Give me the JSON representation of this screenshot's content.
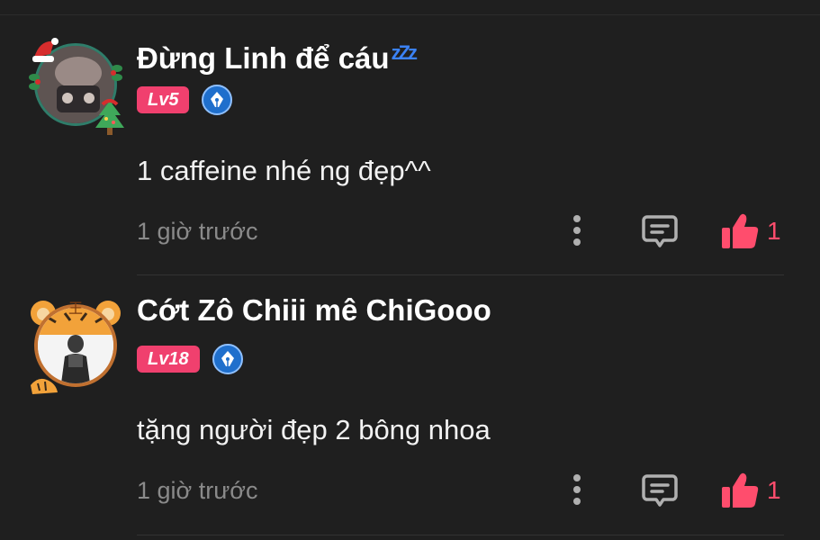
{
  "colors": {
    "background": "#1f1f1f",
    "level_badge": "#f0406e",
    "like_accent": "#ff4d6d",
    "verified_badge": "#1f6fcc",
    "time_text": "#8a8a8a"
  },
  "comments": [
    {
      "username": "Đừng Linh để cáu",
      "username_suffix": "zZz",
      "level": "Lv5",
      "text": "1 caffeine nhé ng đẹp^^",
      "time": "1 giờ trước",
      "likes": "1",
      "avatar_frame": "christmas-frame"
    },
    {
      "username": "Cớt Zô Chiii mê ChiGooo",
      "level": "Lv18",
      "text": "tặng người đẹp 2 bông nhoa",
      "time": "1 giờ trước",
      "likes": "1",
      "avatar_frame": "tiger-frame"
    }
  ],
  "icons": {
    "more": "more-vertical-icon",
    "reply": "comment-reply-icon",
    "like": "thumbs-up-icon",
    "badge": "pen-nib-badge-icon"
  }
}
